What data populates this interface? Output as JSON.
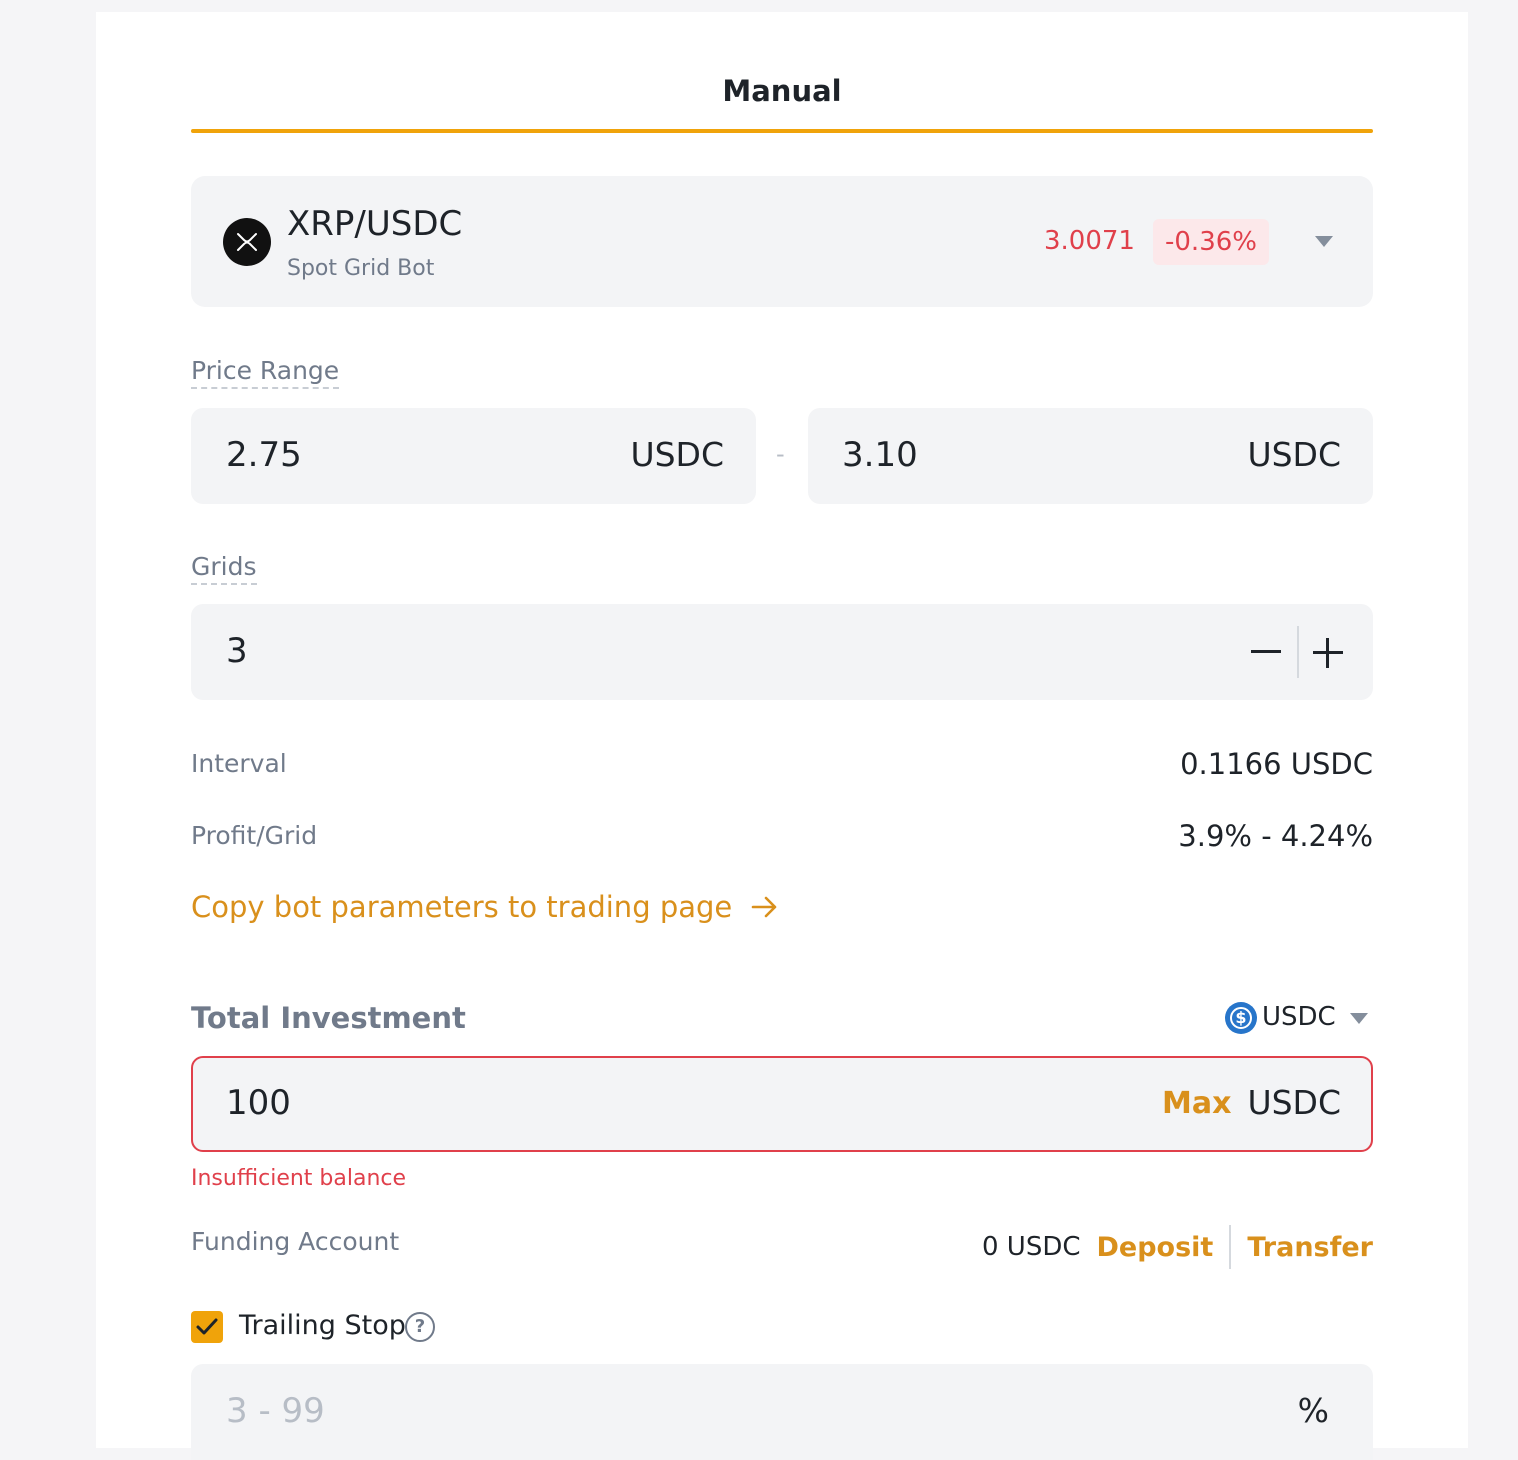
{
  "tab": {
    "label": "Manual"
  },
  "pair": {
    "name": "XRP/USDC",
    "subtitle": "Spot Grid Bot",
    "price": "3.0071",
    "change": "-0.36%",
    "logo_icon": "xrp-icon"
  },
  "price_range": {
    "label": "Price Range",
    "low": "2.75",
    "high": "3.10",
    "unit": "USDC",
    "separator": "-"
  },
  "grids": {
    "label": "Grids",
    "value": "3"
  },
  "stats": {
    "interval_label": "Interval",
    "interval_value": "0.1166 USDC",
    "profit_label": "Profit/Grid",
    "profit_value": "3.9% - 4.24%"
  },
  "copy_link": "Copy bot parameters to trading page",
  "investment": {
    "label": "Total Investment",
    "currency": "USDC",
    "value": "100",
    "max_label": "Max",
    "unit": "USDC",
    "error": "Insufficient balance"
  },
  "funding": {
    "label": "Funding Account",
    "balance": "0 USDC",
    "deposit": "Deposit",
    "transfer": "Transfer"
  },
  "trailing_stop": {
    "label": "Trailing Stop",
    "checked": true,
    "placeholder": "3 - 99",
    "unit": "%"
  },
  "colors": {
    "accent": "#f0a30a",
    "link": "#d9901c",
    "negative": "#e0404b",
    "input_bg": "#f3f4f6"
  }
}
